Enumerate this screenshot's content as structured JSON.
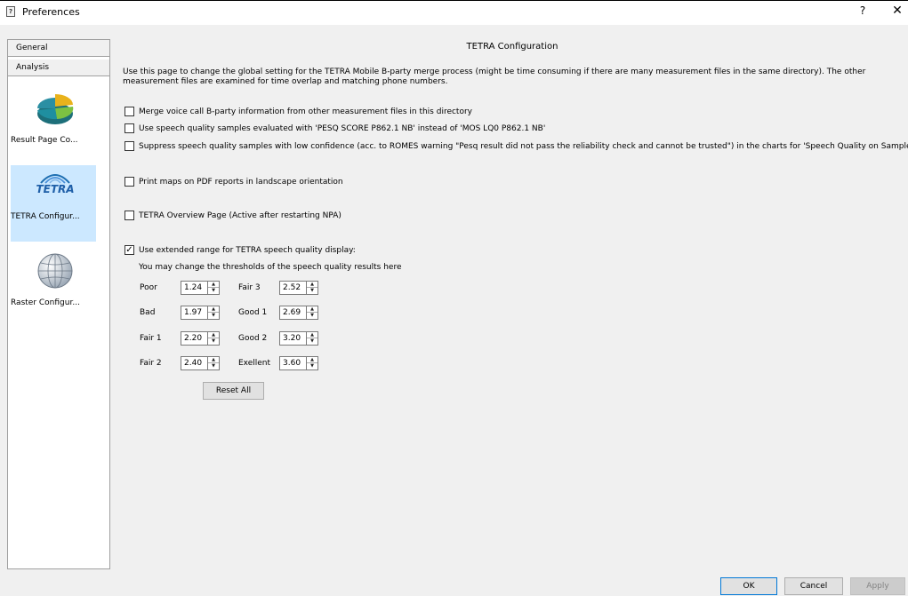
{
  "window": {
    "title": "Preferences",
    "help_label": "?",
    "close_label": "✕",
    "app_icon": "preferences-icon"
  },
  "sidebar": {
    "tabs": [
      {
        "label": "General"
      },
      {
        "label": "Analysis"
      }
    ],
    "items": [
      {
        "label": "Result Page Co...",
        "icon": "pie-chart-icon",
        "selected": false
      },
      {
        "label": "TETRA Configur...",
        "icon": "tetra-logo-icon",
        "icon_text": "TETRA",
        "selected": true
      },
      {
        "label": "Raster Configur...",
        "icon": "globe-icon",
        "selected": false
      }
    ]
  },
  "main": {
    "title": "TETRA Configuration",
    "description": "Use this page to change the global setting for the TETRA Mobile B-party merge process (might be time consuming if there are many measurement files in the same directory). The other measurement files are examined for time overlap and matching phone numbers.",
    "options": [
      {
        "label": "Merge voice call B-party information from other measurement files in this directory",
        "checked": false
      },
      {
        "label": "Use speech quality samples evaluated with 'PESQ SCORE P862.1 NB' instead of 'MOS LQ0 P862.1 NB'",
        "checked": false
      },
      {
        "label": "Suppress speech quality samples with low confidence (acc. to ROMES warning \"Pesq result did not pass the reliability check and cannot be trusted\") in the charts for 'Speech Quality on Sample Basis'",
        "checked": false
      },
      {
        "label": "Print maps on PDF reports in landscape orientation",
        "checked": false
      },
      {
        "label": "TETRA Overview Page (Active after restarting NPA)",
        "checked": false
      },
      {
        "label": "Use extended range for TETRA speech quality display:",
        "checked": true
      }
    ],
    "threshold_hint": "You may change the thresholds of the speech quality results here",
    "thresholds": [
      {
        "label": "Poor",
        "value": "1.24"
      },
      {
        "label": "Bad",
        "value": "1.97"
      },
      {
        "label": "Fair 1",
        "value": "2.20"
      },
      {
        "label": "Fair 2",
        "value": "2.40"
      },
      {
        "label": "Fair 3",
        "value": "2.52"
      },
      {
        "label": "Good 1",
        "value": "2.69"
      },
      {
        "label": "Good 2",
        "value": "3.20"
      },
      {
        "label": "Exellent",
        "value": "3.60"
      }
    ],
    "reset_label": "Reset All"
  },
  "footer": {
    "ok_label": "OK",
    "cancel_label": "Cancel",
    "apply_label": "Apply",
    "apply_enabled": false
  },
  "colors": {
    "selection": "#cce8ff",
    "accent": "#0078d7",
    "background": "#f0f0f0"
  }
}
